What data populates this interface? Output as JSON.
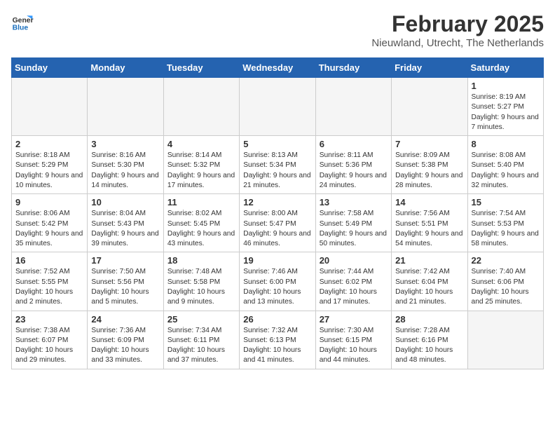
{
  "logo": {
    "line1": "General",
    "line2": "Blue"
  },
  "title": "February 2025",
  "location": "Nieuwland, Utrecht, The Netherlands",
  "days_of_week": [
    "Sunday",
    "Monday",
    "Tuesday",
    "Wednesday",
    "Thursday",
    "Friday",
    "Saturday"
  ],
  "weeks": [
    [
      {
        "day": "",
        "info": ""
      },
      {
        "day": "",
        "info": ""
      },
      {
        "day": "",
        "info": ""
      },
      {
        "day": "",
        "info": ""
      },
      {
        "day": "",
        "info": ""
      },
      {
        "day": "",
        "info": ""
      },
      {
        "day": "1",
        "info": "Sunrise: 8:19 AM\nSunset: 5:27 PM\nDaylight: 9 hours and 7 minutes."
      }
    ],
    [
      {
        "day": "2",
        "info": "Sunrise: 8:18 AM\nSunset: 5:29 PM\nDaylight: 9 hours and 10 minutes."
      },
      {
        "day": "3",
        "info": "Sunrise: 8:16 AM\nSunset: 5:30 PM\nDaylight: 9 hours and 14 minutes."
      },
      {
        "day": "4",
        "info": "Sunrise: 8:14 AM\nSunset: 5:32 PM\nDaylight: 9 hours and 17 minutes."
      },
      {
        "day": "5",
        "info": "Sunrise: 8:13 AM\nSunset: 5:34 PM\nDaylight: 9 hours and 21 minutes."
      },
      {
        "day": "6",
        "info": "Sunrise: 8:11 AM\nSunset: 5:36 PM\nDaylight: 9 hours and 24 minutes."
      },
      {
        "day": "7",
        "info": "Sunrise: 8:09 AM\nSunset: 5:38 PM\nDaylight: 9 hours and 28 minutes."
      },
      {
        "day": "8",
        "info": "Sunrise: 8:08 AM\nSunset: 5:40 PM\nDaylight: 9 hours and 32 minutes."
      }
    ],
    [
      {
        "day": "9",
        "info": "Sunrise: 8:06 AM\nSunset: 5:42 PM\nDaylight: 9 hours and 35 minutes."
      },
      {
        "day": "10",
        "info": "Sunrise: 8:04 AM\nSunset: 5:43 PM\nDaylight: 9 hours and 39 minutes."
      },
      {
        "day": "11",
        "info": "Sunrise: 8:02 AM\nSunset: 5:45 PM\nDaylight: 9 hours and 43 minutes."
      },
      {
        "day": "12",
        "info": "Sunrise: 8:00 AM\nSunset: 5:47 PM\nDaylight: 9 hours and 46 minutes."
      },
      {
        "day": "13",
        "info": "Sunrise: 7:58 AM\nSunset: 5:49 PM\nDaylight: 9 hours and 50 minutes."
      },
      {
        "day": "14",
        "info": "Sunrise: 7:56 AM\nSunset: 5:51 PM\nDaylight: 9 hours and 54 minutes."
      },
      {
        "day": "15",
        "info": "Sunrise: 7:54 AM\nSunset: 5:53 PM\nDaylight: 9 hours and 58 minutes."
      }
    ],
    [
      {
        "day": "16",
        "info": "Sunrise: 7:52 AM\nSunset: 5:55 PM\nDaylight: 10 hours and 2 minutes."
      },
      {
        "day": "17",
        "info": "Sunrise: 7:50 AM\nSunset: 5:56 PM\nDaylight: 10 hours and 5 minutes."
      },
      {
        "day": "18",
        "info": "Sunrise: 7:48 AM\nSunset: 5:58 PM\nDaylight: 10 hours and 9 minutes."
      },
      {
        "day": "19",
        "info": "Sunrise: 7:46 AM\nSunset: 6:00 PM\nDaylight: 10 hours and 13 minutes."
      },
      {
        "day": "20",
        "info": "Sunrise: 7:44 AM\nSunset: 6:02 PM\nDaylight: 10 hours and 17 minutes."
      },
      {
        "day": "21",
        "info": "Sunrise: 7:42 AM\nSunset: 6:04 PM\nDaylight: 10 hours and 21 minutes."
      },
      {
        "day": "22",
        "info": "Sunrise: 7:40 AM\nSunset: 6:06 PM\nDaylight: 10 hours and 25 minutes."
      }
    ],
    [
      {
        "day": "23",
        "info": "Sunrise: 7:38 AM\nSunset: 6:07 PM\nDaylight: 10 hours and 29 minutes."
      },
      {
        "day": "24",
        "info": "Sunrise: 7:36 AM\nSunset: 6:09 PM\nDaylight: 10 hours and 33 minutes."
      },
      {
        "day": "25",
        "info": "Sunrise: 7:34 AM\nSunset: 6:11 PM\nDaylight: 10 hours and 37 minutes."
      },
      {
        "day": "26",
        "info": "Sunrise: 7:32 AM\nSunset: 6:13 PM\nDaylight: 10 hours and 41 minutes."
      },
      {
        "day": "27",
        "info": "Sunrise: 7:30 AM\nSunset: 6:15 PM\nDaylight: 10 hours and 44 minutes."
      },
      {
        "day": "28",
        "info": "Sunrise: 7:28 AM\nSunset: 6:16 PM\nDaylight: 10 hours and 48 minutes."
      },
      {
        "day": "",
        "info": ""
      }
    ]
  ]
}
